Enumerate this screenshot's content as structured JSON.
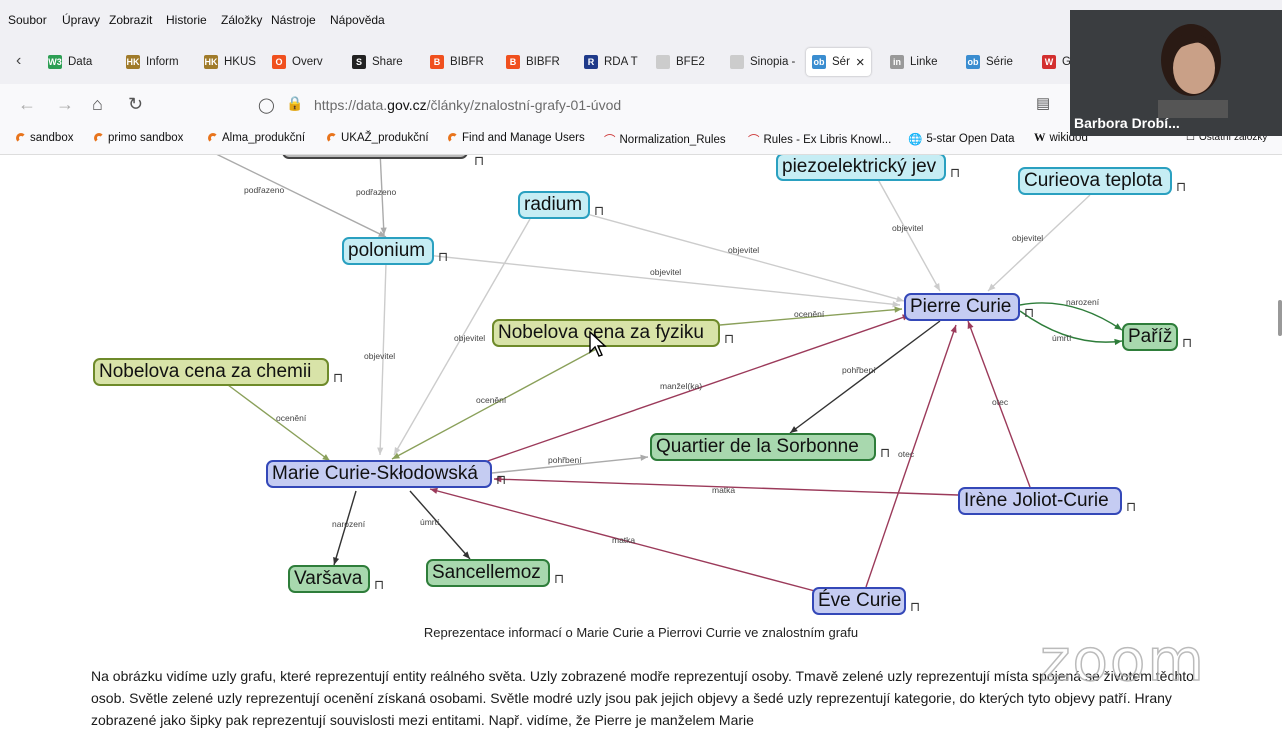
{
  "menu": [
    "Soubor",
    "Úpravy",
    "Zobrazit",
    "Historie",
    "Záložky",
    "Nástroje",
    "Nápověda"
  ],
  "tabs": [
    {
      "fav": "W3",
      "label": "Data",
      "color": "#2d9e54"
    },
    {
      "fav": "HK",
      "label": "Inform",
      "color": "#a07b2a"
    },
    {
      "fav": "HK",
      "label": "HKUS",
      "color": "#a07b2a"
    },
    {
      "fav": "O",
      "label": "Overv",
      "color": "#f0501e"
    },
    {
      "fav": "S",
      "label": "Share",
      "color": "#222222"
    },
    {
      "fav": "B",
      "label": "BIBFR",
      "color": "#f0501e"
    },
    {
      "fav": "B",
      "label": "BIBFR",
      "color": "#f0501e"
    },
    {
      "fav": "R",
      "label": "RDA T",
      "color": "#1f3a8a"
    },
    {
      "fav": "",
      "label": "BFE2",
      "color": "#cccccc"
    },
    {
      "fav": "",
      "label": "Sinopia -",
      "color": "#cccccc"
    },
    {
      "fav": "ob",
      "label": "Sér",
      "color": "#3a8dd0",
      "active": true
    },
    {
      "fav": "in",
      "label": "Linke",
      "color": "#999999"
    },
    {
      "fav": "ob",
      "label": "Série",
      "color": "#3a8dd0"
    },
    {
      "fav": "W",
      "label": "G",
      "color": "#d32f2f"
    }
  ],
  "address": {
    "prefix": "https://data.",
    "domain": "gov.cz",
    "path": "/články/znalostní-grafy-01-úvod"
  },
  "bookmarks": [
    "sandbox",
    "primo sandbox",
    "Alma_produkční",
    "UKAŽ_produkční",
    "Find and Manage Users",
    "Normalization_Rules",
    "Rules - Ex Libris Knowl...",
    "5-star Open Data",
    "wikidod",
    "Ostatní záložky"
  ],
  "video": {
    "name": "Barbora Drobí..."
  },
  "nodes": [
    {
      "id": "piezo",
      "label": "piezoelektrický jev",
      "kind": "cyan"
    },
    {
      "id": "curieova",
      "label": "Curieova teplota",
      "kind": "cyan"
    },
    {
      "id": "radium",
      "label": "radium",
      "kind": "cyan"
    },
    {
      "id": "polonium",
      "label": "polonium",
      "kind": "cyan"
    },
    {
      "id": "pierre",
      "label": "Pierre Curie",
      "kind": "blue"
    },
    {
      "id": "pariz",
      "label": "Paříž",
      "kind": "green"
    },
    {
      "id": "nobfyz",
      "label": "Nobelova cena za fyziku",
      "kind": "lgreen"
    },
    {
      "id": "nobchem",
      "label": "Nobelova cena za chemii",
      "kind": "lgreen"
    },
    {
      "id": "marie",
      "label": "Marie Curie-Skłodowská",
      "kind": "blue"
    },
    {
      "id": "sorbonne",
      "label": "Quartier de la Sorbonne",
      "kind": "green"
    },
    {
      "id": "irene",
      "label": "Irène Joliot-Curie",
      "kind": "blue"
    },
    {
      "id": "varsava",
      "label": "Varšava",
      "kind": "green"
    },
    {
      "id": "sancellemoz",
      "label": "Sancellemoz",
      "kind": "green"
    },
    {
      "id": "eve",
      "label": "Éve Curie",
      "kind": "blue"
    }
  ],
  "edges": [
    {
      "label": "podřazeno"
    },
    {
      "label": "podřazeno"
    },
    {
      "label": "objevitel"
    },
    {
      "label": "objevitel"
    },
    {
      "label": "objevitel"
    },
    {
      "label": "objevitel"
    },
    {
      "label": "objevitel"
    },
    {
      "label": "objevitel"
    },
    {
      "label": "ocenění"
    },
    {
      "label": "narození"
    },
    {
      "label": "úmrtí"
    },
    {
      "label": "ocenění"
    },
    {
      "label": "manžel(ka)"
    },
    {
      "label": "ocenění"
    },
    {
      "label": "pohřbení"
    },
    {
      "label": "pohřbení"
    },
    {
      "label": "otec"
    },
    {
      "label": "otec"
    },
    {
      "label": "matka"
    },
    {
      "label": "matka"
    },
    {
      "label": "narození"
    },
    {
      "label": "úmrtí"
    }
  ],
  "caption": "Reprezentace informací o Marie Curie a Pierrovi Currie ve znalostním grafu",
  "paragraph": "Na obrázku vidíme uzly grafu, které reprezentují entity reálného světa. Uzly zobrazené modře reprezentují osoby. Tmavě zelené uzly reprezentují místa spojená se životem těchto osob. Světle zelené uzly reprezentují ocenění získaná osobami. Světle modré uzly jsou pak jejich objevy a šedé uzly reprezentují kategorie, do kterých tyto objevy patří. Hrany zobrazené jako šipky pak reprezentují souvislosti mezi entitami. Např. vidíme, že Pierre je manželem Marie",
  "watermark": "zoom",
  "colors": {
    "person": "#3448b8",
    "place": "#2e7d3a",
    "award": "#6e8a2a",
    "discovery": "#2aa0c0",
    "spouse_edge": "#9b3a5a"
  }
}
